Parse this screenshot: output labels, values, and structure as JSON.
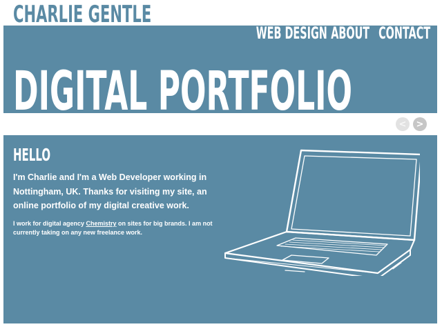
{
  "site": {
    "logo": "CHARLIE GENTLE"
  },
  "nav": {
    "items": [
      {
        "label": "WEB DESIGN"
      },
      {
        "label": "ABOUT"
      },
      {
        "label": "CONTACT"
      }
    ]
  },
  "hero": {
    "title": "DIGITAL PORTFOLIO"
  },
  "slider": {
    "prev_glyph": "<",
    "next_glyph": ">"
  },
  "content": {
    "heading": "HELLO",
    "intro": "I'm Charlie and I'm a Web Developer working in Nottingham, UK. Thanks for visiting my site, an online portfolio of my digital creative work.",
    "sub_before": "I work for digital agency ",
    "sub_link": "Chemistry",
    "sub_after": " on sites for big brands. I am not currently taking on any new freelance work.",
    "illustration": "laptop-sketch"
  },
  "colors": {
    "accent": "#5a8aa4",
    "background": "#ffffff",
    "text_on_accent": "#ffffff"
  }
}
